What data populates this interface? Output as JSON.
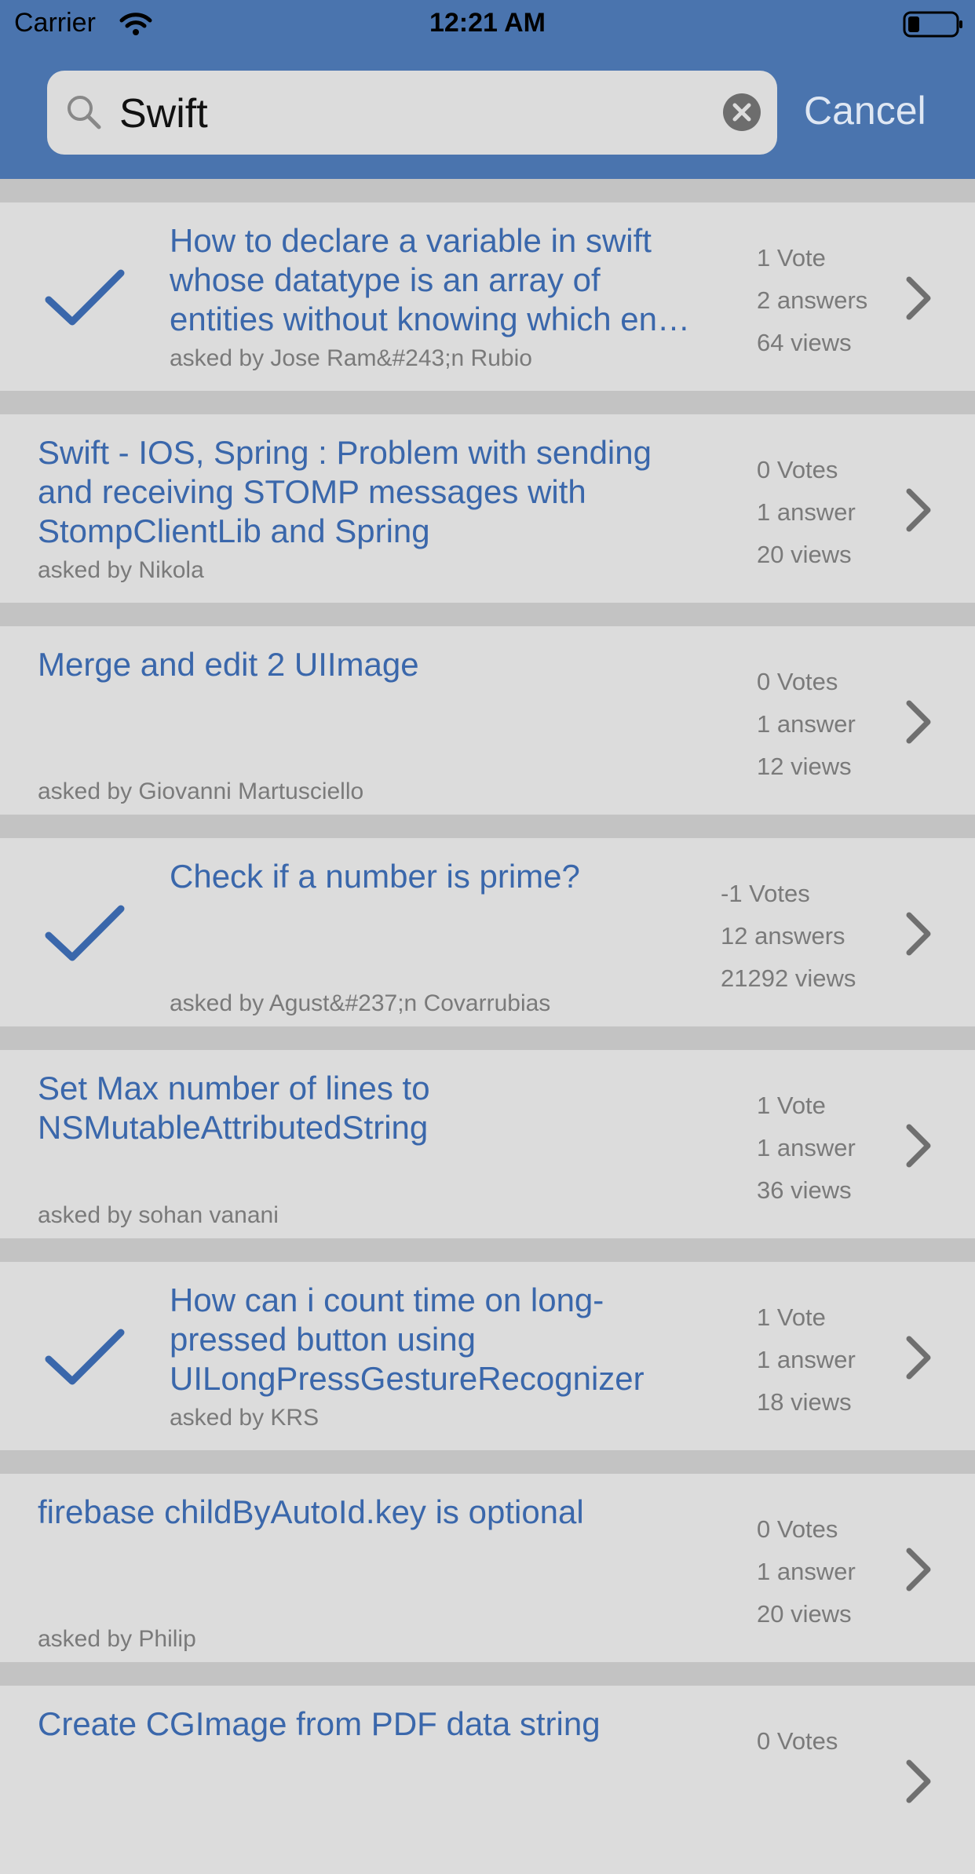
{
  "status_bar": {
    "carrier": "Carrier",
    "time": "12:21 AM"
  },
  "search": {
    "query": "Swift",
    "cancel_label": "Cancel"
  },
  "results": [
    {
      "accepted": true,
      "title": "How to declare a variable in swift whose datatype is an array of entities without knowing which en…",
      "author": "asked by Jose Ram&#243;n Rubio",
      "votes": "1 Vote",
      "answers": "2 answers",
      "views": "64 views"
    },
    {
      "accepted": false,
      "title": "Swift - IOS, Spring : Problem with sending and receiving STOMP messages with StompClientLib and Spring",
      "author": "asked by Nikola",
      "votes": "0 Votes",
      "answers": "1 answer",
      "views": "20 views"
    },
    {
      "accepted": false,
      "title": "Merge and edit 2 UIImage",
      "author": "asked by Giovanni Martusciello",
      "votes": "0 Votes",
      "answers": "1 answer",
      "views": "12 views"
    },
    {
      "accepted": true,
      "title": "Check if a number is prime?",
      "author": "asked by Agust&#237;n Covarrubias",
      "votes": "-1 Votes",
      "answers": "12 answers",
      "views": "21292 views"
    },
    {
      "accepted": false,
      "title": "Set Max number of lines to NSMutableAttributedString",
      "author": "asked by sohan vanani",
      "votes": "1 Vote",
      "answers": "1 answer",
      "views": "36 views"
    },
    {
      "accepted": true,
      "title": "How can i count time on long-pressed button using UILongPressGestureRecognizer",
      "author": "asked by KRS",
      "votes": "1 Vote",
      "answers": "1 answer",
      "views": "18 views"
    },
    {
      "accepted": false,
      "title": "firebase childByAutoId.key is optional",
      "author": "asked by Philip",
      "votes": "0 Votes",
      "answers": "1 answer",
      "views": "20 views"
    },
    {
      "accepted": false,
      "title": "Create CGImage from PDF data string",
      "author": "",
      "votes": "0 Votes",
      "answers": "",
      "views": ""
    }
  ],
  "colors": {
    "header": "#4a74ae",
    "title": "#3a67ab",
    "meta": "#7a7a7a",
    "row_bg": "#dcdcdc",
    "separator": "#c3c3c3"
  },
  "icons": {
    "search": "magnifier-icon",
    "clear": "clear-circle-icon",
    "accepted": "checkmark-icon",
    "disclosure": "chevron-right-icon"
  }
}
